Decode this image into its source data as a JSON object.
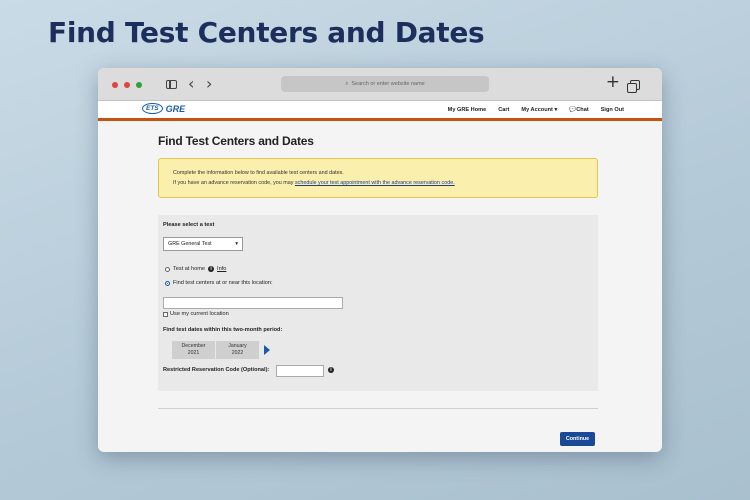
{
  "headline": "Find Test Centers and Dates",
  "browser": {
    "address_placeholder": "Search or enter website name"
  },
  "site": {
    "logo_badge": "ETS",
    "logo_text": "GRE",
    "nav": [
      "My GRE Home",
      "Cart",
      "My Account ▾",
      "Chat",
      "Sign Out"
    ]
  },
  "page": {
    "title": "Find Test Centers and Dates",
    "notice_line1": "Complete the information below to find available test centers and dates.",
    "notice_line2_prefix": "If you have an advance reservation code, you may ",
    "notice_line2_link": "schedule your test appointment with the advance reservation code."
  },
  "form": {
    "select_label": "Please select a test",
    "select_value": "GRE General Test",
    "radio_home_label": "Test at home",
    "radio_home_info": "Info",
    "radio_location_label": "Find test centers at or near this location:",
    "use_location_label": "Use my current location",
    "dates_label": "Find test dates within this two-month period:",
    "months": [
      {
        "month": "December",
        "year": "2021"
      },
      {
        "month": "January",
        "year": "2022"
      }
    ],
    "code_label": "Restricted Reservation Code (Optional):"
  },
  "actions": {
    "continue_label": "Continue"
  },
  "colors": {
    "headline": "#1c2f5c",
    "accent_bar": "#c8510f",
    "notice_bg": "#fbefad",
    "button_bg": "#1a4a96"
  }
}
